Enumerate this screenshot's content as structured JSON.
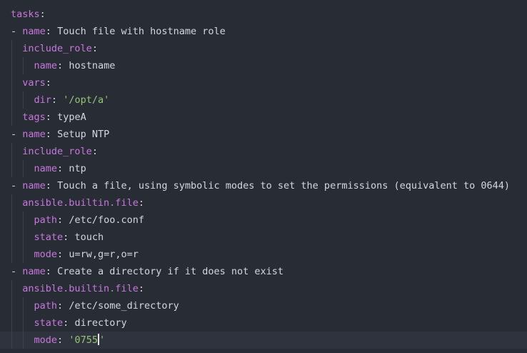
{
  "editor": {
    "language": "yaml",
    "colors": {
      "background": "#282c34",
      "key": "#c678dd",
      "text": "#d4d7dd",
      "string": "#98c379",
      "current_line": "#2f333d"
    },
    "lines": [
      {
        "indent": 0,
        "dash": false,
        "key": "tasks",
        "value": "",
        "type": "none"
      },
      {
        "indent": 0,
        "dash": true,
        "key": "name",
        "value": "Touch file with hostname role",
        "type": "plain"
      },
      {
        "indent": 1,
        "dash": false,
        "key": "include_role",
        "value": "",
        "type": "none"
      },
      {
        "indent": 2,
        "dash": false,
        "key": "name",
        "value": "hostname",
        "type": "plain"
      },
      {
        "indent": 1,
        "dash": false,
        "key": "vars",
        "value": "",
        "type": "none"
      },
      {
        "indent": 2,
        "dash": false,
        "key": "dir",
        "value": "'/opt/a'",
        "type": "string"
      },
      {
        "indent": 1,
        "dash": false,
        "key": "tags",
        "value": "typeA",
        "type": "plain"
      },
      {
        "indent": 0,
        "dash": true,
        "key": "name",
        "value": "Setup NTP",
        "type": "plain"
      },
      {
        "indent": 1,
        "dash": false,
        "key": "include_role",
        "value": "",
        "type": "none"
      },
      {
        "indent": 2,
        "dash": false,
        "key": "name",
        "value": "ntp",
        "type": "plain"
      },
      {
        "indent": 0,
        "dash": true,
        "key": "name",
        "value": "Touch a file, using symbolic modes to set the permissions (equivalent to 0644)",
        "type": "plain"
      },
      {
        "indent": 1,
        "dash": false,
        "key": "ansible.builtin.file",
        "value": "",
        "type": "none"
      },
      {
        "indent": 2,
        "dash": false,
        "key": "path",
        "value": "/etc/foo.conf",
        "type": "plain"
      },
      {
        "indent": 2,
        "dash": false,
        "key": "state",
        "value": "touch",
        "type": "plain"
      },
      {
        "indent": 2,
        "dash": false,
        "key": "mode",
        "value": "u=rw,g=r,o=r",
        "type": "plain"
      },
      {
        "indent": 0,
        "dash": true,
        "key": "name",
        "value": "Create a directory if it does not exist",
        "type": "plain"
      },
      {
        "indent": 1,
        "dash": false,
        "key": "ansible.builtin.file",
        "value": "",
        "type": "none"
      },
      {
        "indent": 2,
        "dash": false,
        "key": "path",
        "value": "/etc/some_directory",
        "type": "plain"
      },
      {
        "indent": 2,
        "dash": false,
        "key": "state",
        "value": "directory",
        "type": "plain"
      },
      {
        "indent": 2,
        "dash": false,
        "key": "mode",
        "value": "'0755'",
        "type": "string",
        "current": true,
        "cursor": true
      }
    ]
  }
}
